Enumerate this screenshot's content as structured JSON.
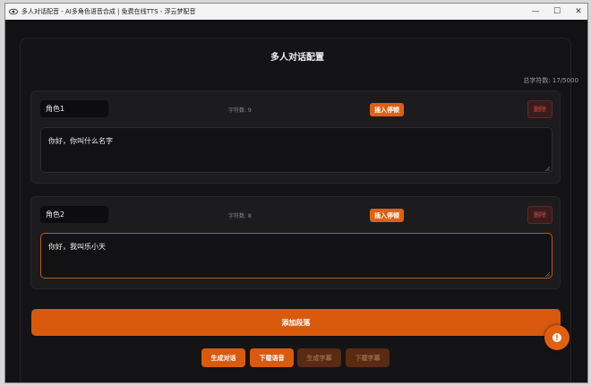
{
  "window": {
    "title": "多人对话配音 - AI多角色语音合成 | 免费在线TTS - 浮云梦配音",
    "minimize_glyph": "—",
    "maximize_glyph": "☐",
    "close_glyph": "✕"
  },
  "page": {
    "title": "多人对话配置",
    "total_count": "总字符数: 17/5000"
  },
  "segments": [
    {
      "role": "角色1",
      "char_count": "字符数: 9",
      "insert_label": "插入停顿",
      "delete_label": "删除",
      "text": "你好，你叫什么名字"
    },
    {
      "role": "角色2",
      "char_count": "字符数: 8",
      "insert_label": "插入停顿",
      "delete_label": "删除",
      "text": "你好，我叫乐小天"
    }
  ],
  "add_segment_label": "添加段落",
  "actions": {
    "generate_dialog": "生成对话",
    "download_audio": "下载语音",
    "generate_subtitle": "生成字幕",
    "download_subtitle": "下载字幕"
  },
  "colors": {
    "accent": "#d95a0c",
    "accent_disabled": "#5a2a12",
    "danger": "#d04a4a",
    "background": "#121214"
  },
  "icons": {
    "app": "eye-icon",
    "fab": "alert-icon"
  }
}
